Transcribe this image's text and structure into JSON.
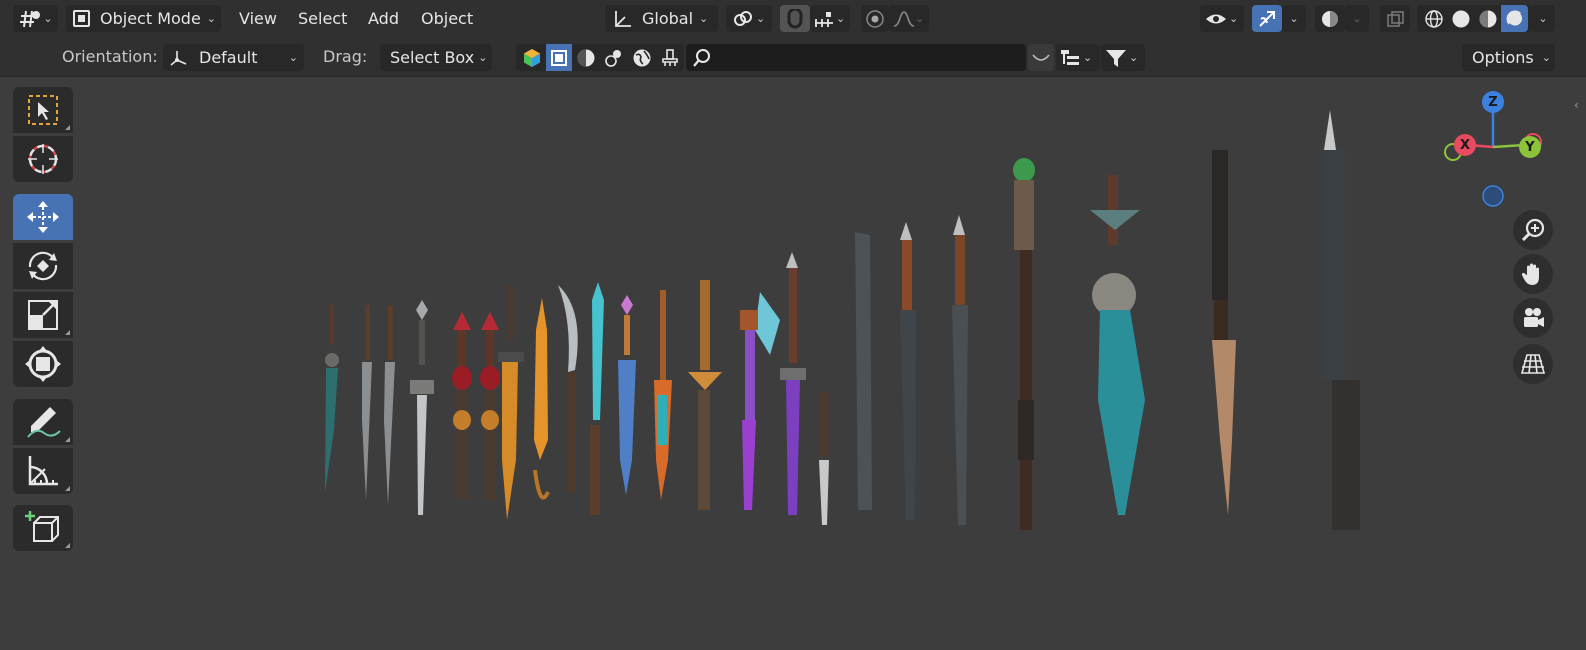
{
  "header": {
    "mode_label": "Object Mode",
    "menus": [
      "View",
      "Select",
      "Add",
      "Object"
    ],
    "transform_orientation": "Global"
  },
  "subheader": {
    "orientation_label": "Orientation:",
    "orientation_value": "Default",
    "drag_label": "Drag:",
    "drag_value": "Select Box",
    "options_label": "Options"
  },
  "gizmo": {
    "z": "Z",
    "x": "X",
    "y": "Y"
  },
  "toolbar": [
    "select-box-tool",
    "cursor-tool",
    "move-tool",
    "rotate-tool",
    "scale-tool",
    "transform-tool",
    "annotate-tool",
    "measure-tool",
    "add-cube-tool"
  ],
  "active_tool": "move-tool",
  "colors": {
    "accent": "#4772b3",
    "bg": "#3d3d3d",
    "header": "#303030"
  }
}
